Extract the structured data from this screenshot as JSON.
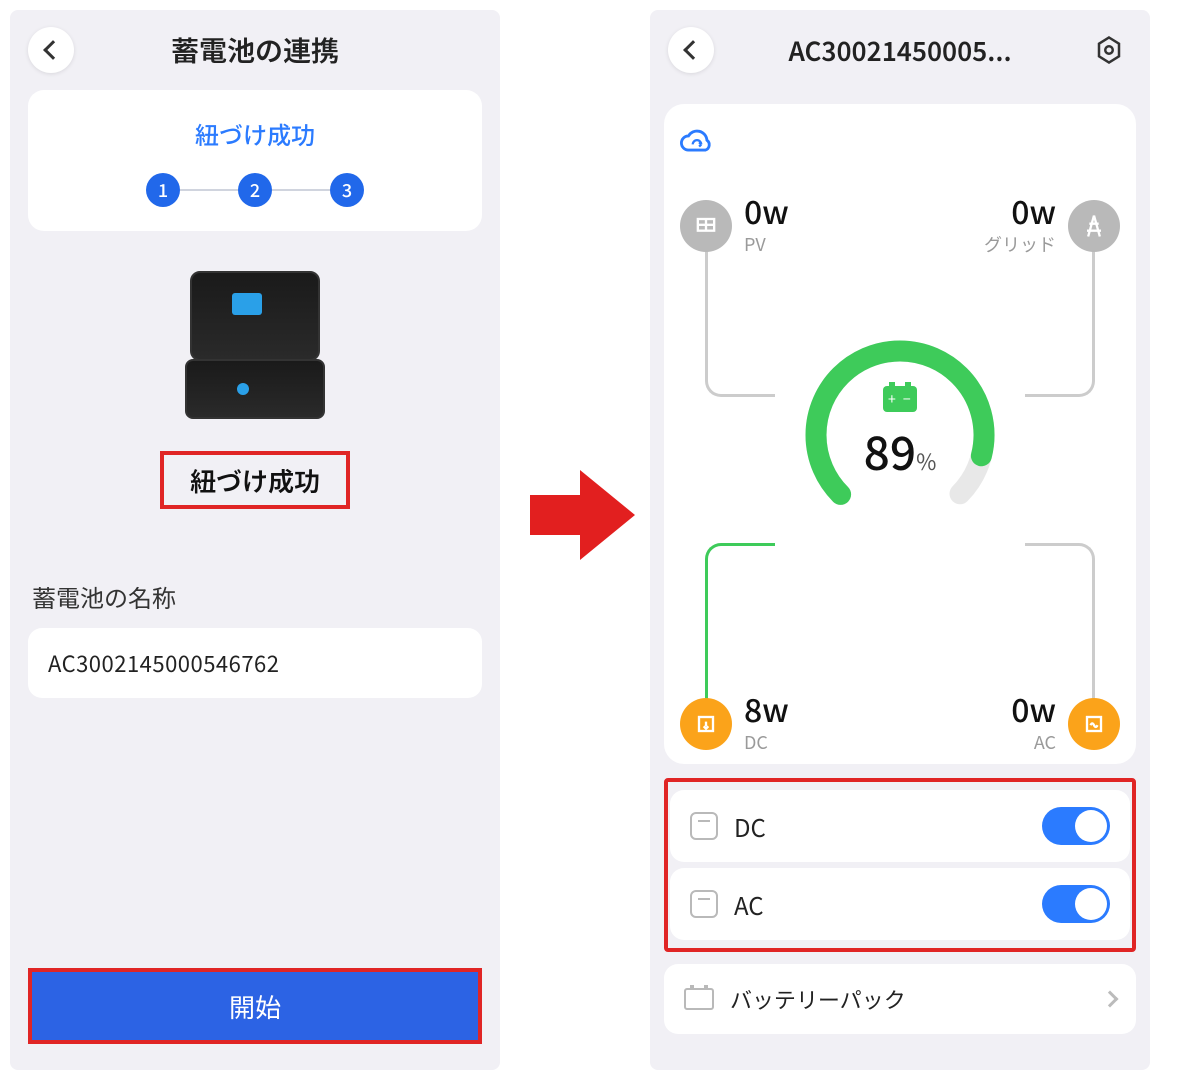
{
  "left": {
    "header_title": "蓄電池の連携",
    "steps_title": "紐づけ成功",
    "steps": [
      "1",
      "2",
      "3"
    ],
    "success_label": "紐づけ成功",
    "name_section_label": "蓄電池の名称",
    "device_name": "AC3002145000546762",
    "start_button": "開始"
  },
  "right": {
    "header_title": "AC30021450005...",
    "battery_percent": "89",
    "percent_symbol": "%",
    "inputs": {
      "pv": {
        "value": "0w",
        "label": "PV"
      },
      "grid": {
        "value": "0w",
        "label": "グリッド"
      }
    },
    "outputs": {
      "dc": {
        "value": "8w",
        "label": "DC"
      },
      "ac": {
        "value": "0w",
        "label": "AC"
      }
    },
    "toggles": {
      "dc": {
        "label": "DC",
        "on": true
      },
      "ac": {
        "label": "AC",
        "on": true
      }
    },
    "battery_pack_label": "バッテリーパック"
  },
  "colors": {
    "accent_blue": "#2b7bff",
    "highlight_red": "#e02525",
    "gauge_green": "#3ecb5a",
    "io_orange": "#fba31a"
  }
}
